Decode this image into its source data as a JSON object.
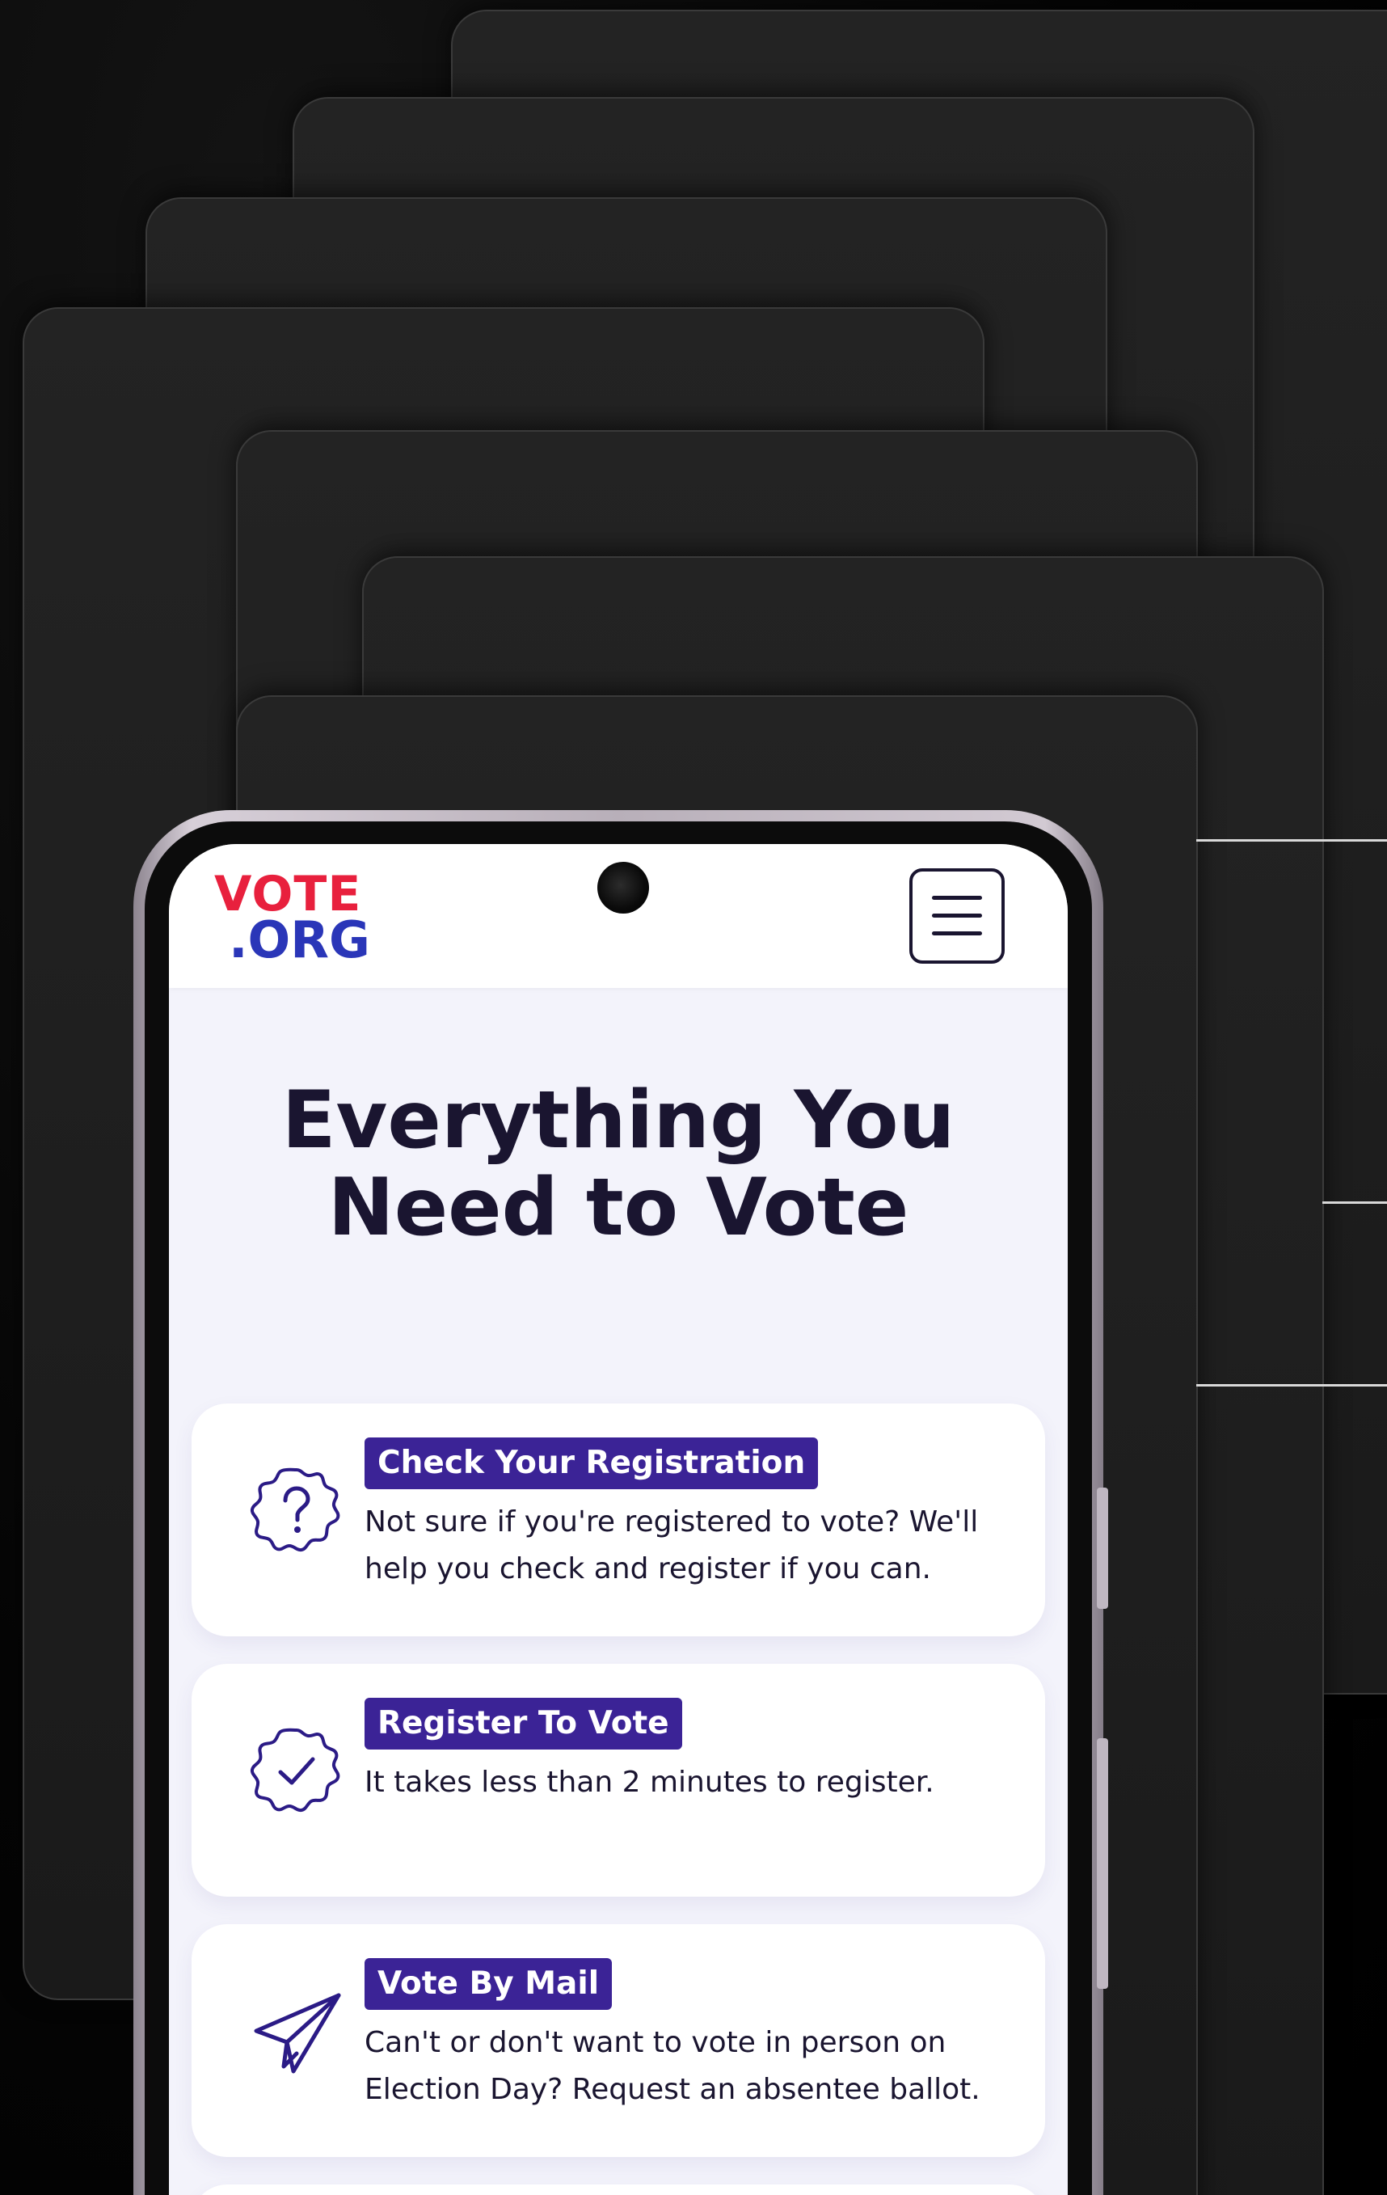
{
  "site": {
    "logo_top": "VOTE",
    "logo_bottom": ".ORG"
  },
  "hero": {
    "title_line1": "Everything You",
    "title_line2": "Need to Vote"
  },
  "cards": [
    {
      "title": "Check Your Registration",
      "description_line1": "Not sure if you're registered to vote? We'll",
      "description_line2": "help you check and register if you can.",
      "icon": "question-badge-icon"
    },
    {
      "title": "Register To Vote",
      "description_line1": "It takes less than 2 minutes to register.",
      "description_line2": "",
      "icon": "check-badge-icon"
    },
    {
      "title": "Vote By Mail",
      "description_line1": "Can't or don't want to vote in person on",
      "description_line2": "Election Day? Request an absentee ballot.",
      "icon": "paper-plane-icon"
    }
  ],
  "colors": {
    "accent": "#3b2396",
    "logo_red": "#e8203d",
    "logo_blue": "#2a36b8",
    "text_dark": "#1a1530",
    "screen_bg": "#f3f3fb"
  }
}
